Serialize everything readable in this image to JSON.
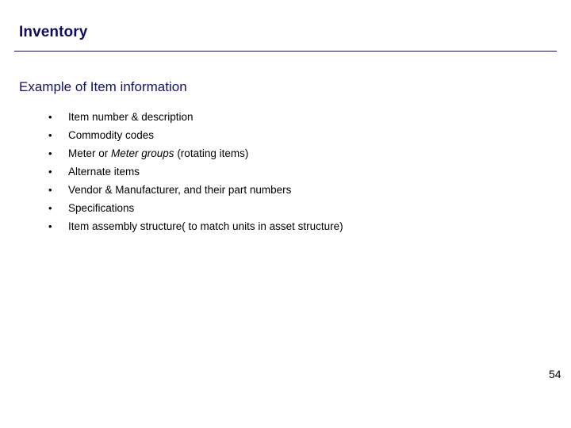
{
  "slide": {
    "title": "Inventory",
    "subtitle": "Example of Item information",
    "page_number": "54",
    "bullet_marker": "•",
    "accent_color": "#0d0d5c",
    "rule_color": "#131347",
    "body_color": "#000000",
    "background_color": "#ffffff",
    "bullets": [
      {
        "text": "Item number & description",
        "pre": "Item number & description",
        "italic": "",
        "post": ""
      },
      {
        "text": "Commodity codes",
        "pre": "Commodity codes",
        "italic": "",
        "post": ""
      },
      {
        "text": "Meter or Meter groups (rotating items)",
        "pre": "Meter or ",
        "italic": "Meter groups",
        "post": " (rotating items)"
      },
      {
        "text": "Alternate items",
        "pre": "Alternate items",
        "italic": "",
        "post": ""
      },
      {
        "text": "Vendor & Manufacturer, and their part numbers",
        "pre": "Vendor & Manufacturer, and their part numbers",
        "italic": "",
        "post": ""
      },
      {
        "text": "Specifications",
        "pre": "Specifications",
        "italic": "",
        "post": ""
      },
      {
        "text": "Item assembly structure( to match units in asset structure)",
        "pre": "Item assembly structure( to match units in asset structure)",
        "italic": "",
        "post": ""
      }
    ]
  }
}
